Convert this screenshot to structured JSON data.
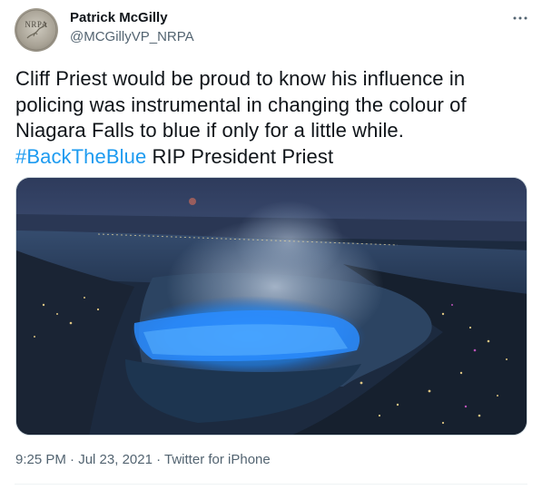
{
  "author": {
    "display_name": "Patrick McGilly",
    "handle": "@MCGillyVP_NRPA",
    "avatar_text": "NRPA"
  },
  "tweet": {
    "text_before": "Cliff Priest would be proud to know his influence in policing was instrumental in changing the colour of Niagara Falls to blue if only for a little while. ",
    "hashtag": "#BackTheBlue",
    "text_after": " RIP President Priest"
  },
  "meta": {
    "time": "9:25 PM",
    "separator": " · ",
    "date": "Jul 23, 2021",
    "source": "Twitter for iPhone"
  },
  "icons": {
    "more": "more-horizontal-icon"
  },
  "colors": {
    "link": "#1d9bf0",
    "secondary_text": "#536471",
    "falls_light": "#1e90ff"
  }
}
